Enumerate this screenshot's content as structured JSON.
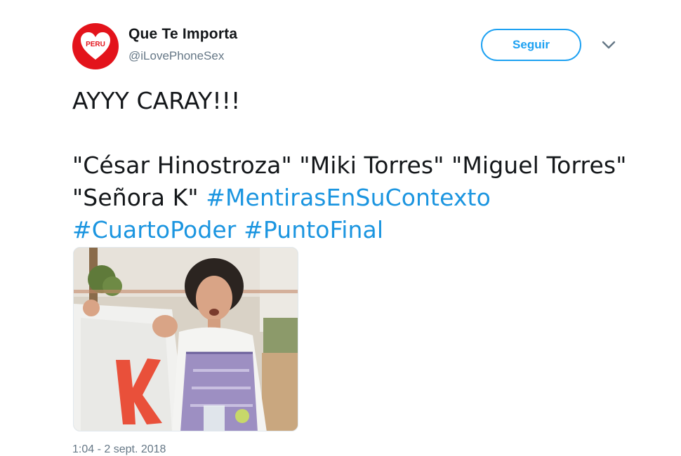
{
  "tweet": {
    "author_name": "Que Te Importa",
    "author_handle": "@iLovePhoneSex",
    "avatar_text": "PERU",
    "follow_label": "Seguir",
    "text_line1": "AYYY CARAY!!!",
    "text_line2_plain": "\"César Hinostroza\" \"Miki Torres\" \"Miguel Torres\" \"Señora K\"",
    "hashtags": [
      "#MentirasEnSuContexto",
      "#CuartoPoder",
      "#PuntoFinal"
    ],
    "media_letter": "K",
    "timestamp": "1:04 - 2 sept. 2018"
  },
  "colors": {
    "accent": "#1da1f2",
    "hashtag": "#1b95e0",
    "avatar_red": "#e3131b",
    "text": "#14171a",
    "secondary": "#657786"
  },
  "icons": {
    "avatar": "heart-logo-icon",
    "menu": "chevron-down-icon"
  }
}
